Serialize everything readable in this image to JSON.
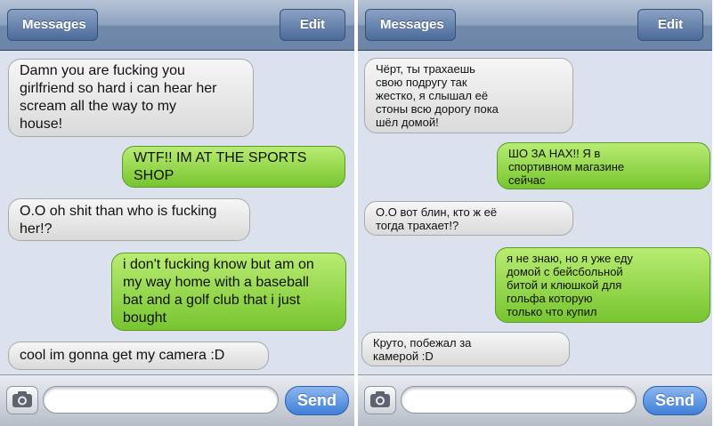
{
  "left": {
    "nav": {
      "back_label": "Messages",
      "edit_label": "Edit"
    },
    "messages": [
      {
        "side": "received",
        "text": "Damn you are fucking you\ngirlfriend so hard i can hear her\nscream all the way to my\nhouse!"
      },
      {
        "side": "sent",
        "text": "WTF!! IM AT THE SPORTS\nSHOP"
      },
      {
        "side": "received",
        "text": "O.O oh shit than who is fucking\nher!?"
      },
      {
        "side": "sent",
        "text": "i don't fucking know but am on\nmy way home with a baseball\nbat and a golf club that i just\nbought"
      },
      {
        "side": "received",
        "text": "cool im gonna get my camera :D"
      }
    ],
    "toolbar": {
      "input_placeholder": "",
      "send_label": "Send",
      "camera_icon": "camera-icon"
    }
  },
  "right": {
    "nav": {
      "back_label": "Messages",
      "edit_label": "Edit"
    },
    "messages": [
      {
        "side": "received",
        "text": "Чёрт, ты трахаешь\nсвою подругу так\nжестко, я слышал её\nстоны всю дорогу пока\nшёл домой!"
      },
      {
        "side": "sent",
        "text": "ШО ЗА НАХ!! Я в\nспортивном магазине\nсейчас"
      },
      {
        "side": "received",
        "text": "О.О вот блин, кто ж её\nтогда трахает!?"
      },
      {
        "side": "sent",
        "text": "я не знаю, но я уже еду\nдомой с бейсбольной\nбитой и клюшкой для\nгольфа которую\nтолько что купил"
      },
      {
        "side": "received",
        "text": "Круто, побежал за\nкамерой :D"
      }
    ],
    "toolbar": {
      "input_placeholder": "",
      "send_label": "Send",
      "camera_icon": "camera-icon"
    }
  },
  "colors": {
    "received_bubble": "#e8e8e8",
    "sent_bubble": "#8fd64a",
    "thread_background": "#dbe2ed",
    "send_button": "#4f8de0"
  }
}
